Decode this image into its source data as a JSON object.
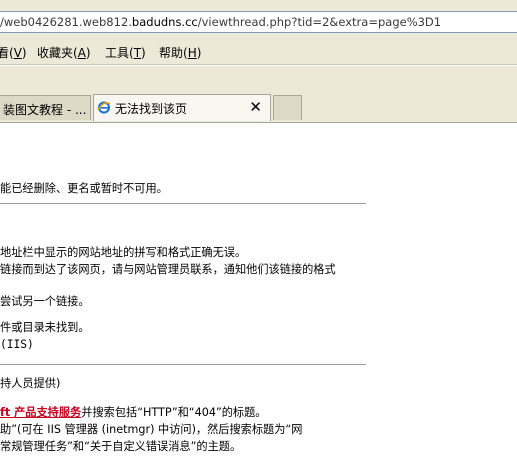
{
  "address": {
    "url_prefix": "/web0426281.web812.",
    "url_host": "badudns.cc",
    "url_suffix": "/viewthread.php?tid=2&extra=page%3D1"
  },
  "menu": [
    {
      "label": "看(",
      "key": "V",
      "end": ")"
    },
    {
      "label": "收藏夹(",
      "key": "A",
      "end": ")"
    },
    {
      "label": "工具(",
      "key": "T",
      "end": ")"
    },
    {
      "label": "帮助(",
      "key": "H",
      "end": ")"
    }
  ],
  "tabs": {
    "tab1_label": "装图文教程 - ...",
    "tab2_label": "无法找到该页",
    "close_glyph": "✕"
  },
  "page": {
    "line1": "能已经删除、更名或暂时不可用。",
    "line2": "地址栏中显示的网站地址的拼写和格式正确无误。",
    "line3": "链接而到达了该网页，请与网站管理员联系，通知他们该链接的格式",
    "line4": "尝试另一个链接。",
    "line5": "件或目录未找到。",
    "line6": "(IIS)",
    "line7": "持人员提供)",
    "line8_link": "ft 产品支持服务",
    "line8_rest": "并搜索包括“HTTP”和“404”的标题。",
    "line9": "助”(可在 IIS 管理器 (inetmgr) 中访问)，然后搜索标题为“网",
    "line10": "常规管理任务”和“关于自定义错误消息”的主题。"
  }
}
